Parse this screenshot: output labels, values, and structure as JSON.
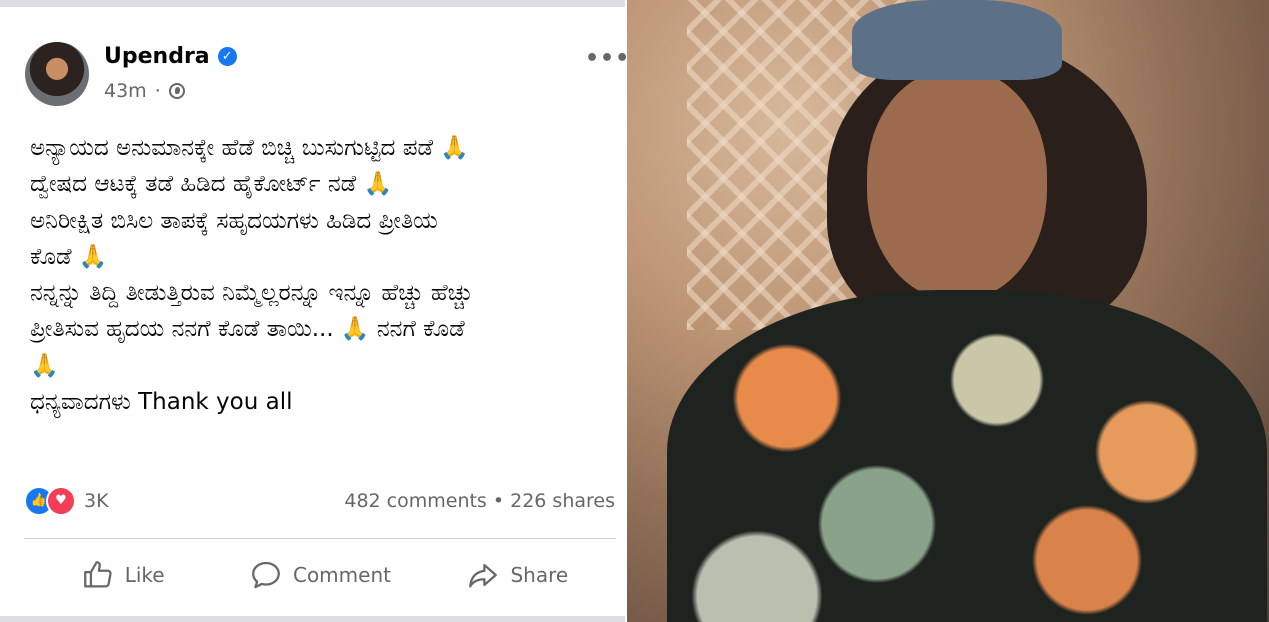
{
  "post": {
    "author": "Upendra",
    "verified_icon": "verified-badge-icon",
    "time": "43m",
    "privacy_icon": "globe-icon",
    "more_label": "•••",
    "body_lines": [
      "ಅನ್ಯಾಯದ ಅನುಮಾನಕ್ಕೇ ಹೆಡೆ ಬಿಚ್ಚಿ ಬುಸುಗುಟ್ಟಿದ ಪಡೆ 🙏",
      "ದ್ವೇಷದ ಆಟಕ್ಕೆ ತಡೆ ಹಿಡಿದ ಹೈಕೋರ್ಟ್ ನಡೆ 🙏",
      "ಅನಿರೀಕ್ಷಿತ ಬಿಸಿಲ ತಾಪಕ್ಕೆ ಸಹೃದಯಗಳು ಹಿಡಿದ ಪ್ರೀತಿಯ",
      "ಕೊಡೆ 🙏",
      "ನನ್ನನ್ನು ತಿದ್ದಿ ತೀಡುತ್ತಿರುವ ನಿಮ್ಮೆಲ್ಲರನ್ನೂ ಇನ್ನೂ ಹೆಚ್ಚು ಹೆಚ್ಚು",
      "ಪ್ರೀತಿಸುವ ಹೃದಯ ನನಗೆ ಕೊಡೆ ತಾಯಿ... 🙏 ನನಗೆ ಕೊಡೆ",
      "🙏",
      "ಧನ್ಯವಾದಗಳು Thank you all"
    ],
    "reactions": {
      "like_icon": "like-reaction-icon",
      "love_icon": "love-reaction-icon",
      "count": "3K"
    },
    "counts": "482 comments • 226 shares",
    "actions": {
      "like": "Like",
      "comment": "Comment",
      "share": "Share"
    }
  },
  "colors": {
    "facebook_blue": "#1877f2",
    "love_red": "#f33e58",
    "secondary_text": "#65676b",
    "primary_text": "#050505"
  }
}
